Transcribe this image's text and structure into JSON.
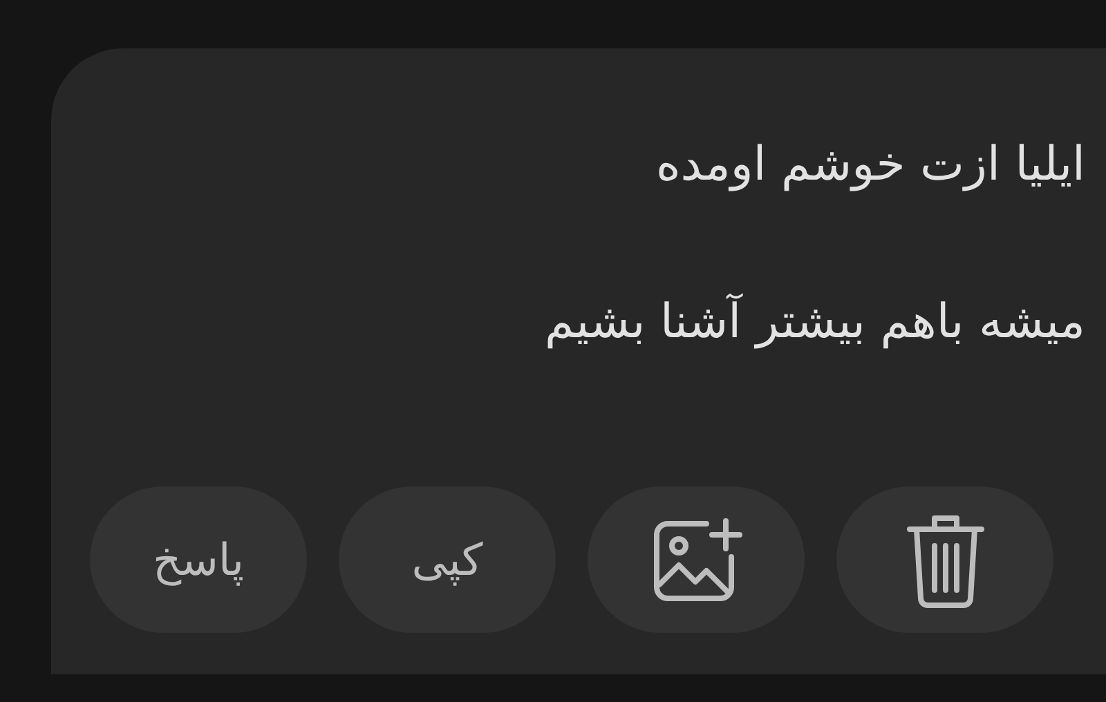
{
  "message": {
    "lines": [
      "ایلیا ازت خوشم اومده",
      "میشه باهم بیشتر آشنا بشیم"
    ]
  },
  "actions": [
    {
      "kind": "delete"
    },
    {
      "kind": "add-image"
    },
    {
      "kind": "text",
      "label": "کپی"
    },
    {
      "kind": "text",
      "label": "پاسخ"
    }
  ]
}
